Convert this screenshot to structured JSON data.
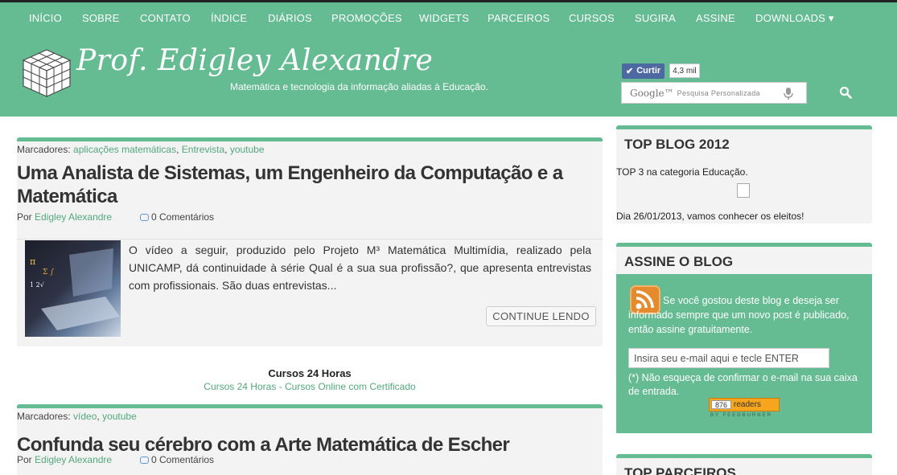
{
  "nav": {
    "items": [
      "INÍCIO",
      "SOBRE",
      "CONTATO",
      "ÍNDICE",
      "DIÁRIOS",
      "PROMOÇÕES",
      "WIDGETS",
      "PARCEIROS",
      "CURSOS",
      "SUGIRA",
      "ASSINE",
      "DOWNLOADS ▾"
    ]
  },
  "header": {
    "title": "Prof. Edigley Alexandre",
    "subtitle": "Matemática e tecnologia da informação aliadas à Educação.",
    "like_label": "Curtir",
    "like_count": "4,3 mil",
    "search_logo": "Google™",
    "search_placeholder": "Pesquisa Personalizada"
  },
  "colors": {
    "accent": "#65bb92",
    "link": "#52a87d"
  },
  "posts": [
    {
      "labels_prefix": "Marcadores:",
      "labels": [
        "aplicações matemáticas",
        "Entrevista",
        "youtube"
      ],
      "title": "Uma Analista de Sistemas, um Engenheiro da Computação e a Matemática",
      "by_prefix": "Por",
      "author": "Edigley Alexandre",
      "comments": "0 Comentários",
      "excerpt": "O vídeo a seguir, produzido pelo Projeto M³ Matemática Multimídia, realizado pela UNICAMP, dá continuidade à série Qual é a sua sua profissão?, que apresenta entrevistas com profissionais. São duas entrevistas...",
      "continue_label": "CONTINUE LENDO"
    },
    {
      "labels_prefix": "Marcadores:",
      "labels": [
        "vídeo",
        "youtube"
      ],
      "title": "Confunda seu cérebro com a Arte Matemática de Escher",
      "by_prefix": "Por",
      "author": "Edigley Alexandre",
      "comments": "0 Comentários"
    }
  ],
  "ad": {
    "title": "Cursos 24 Horas",
    "link": "Cursos 24 Horas - Cursos Online com Certificado"
  },
  "sidebar": {
    "top_blog": {
      "title": "TOP BLOG 2012",
      "line1": "TOP 3 na categoria Educação.",
      "line2": "Dia 26/01/2013, vamos conhecer os eleitos!"
    },
    "subscribe": {
      "title": "ASSINE O BLOG",
      "text": "Se você gostou deste blog e deseja ser informado sempre que um novo post é publicado, então assine gratuitamente.",
      "email_placeholder": "Insira seu e-mail aqui e tecle ENTER",
      "note": "(*) Não esqueça de confirmar o e-mail na sua caixa de entrada.",
      "readers_count": "876",
      "readers_label": "readers",
      "by_feedburner": "BY FEEDBURNER"
    },
    "partners": {
      "title": "TOP PARCEIROS"
    }
  }
}
